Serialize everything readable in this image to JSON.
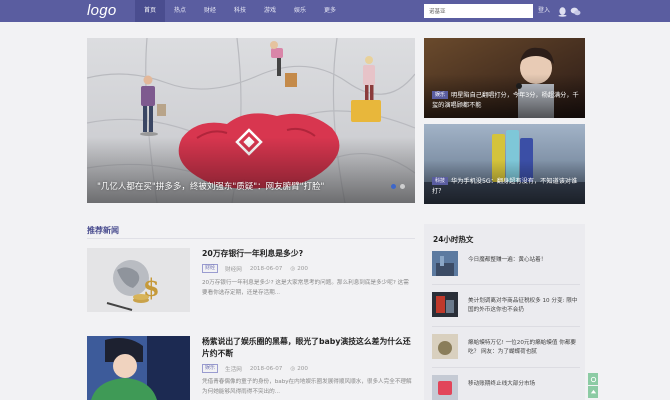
{
  "header": {
    "logo": "logo",
    "nav": [
      "首页",
      "热点",
      "财经",
      "科技",
      "游戏",
      "娱乐",
      "更多"
    ],
    "search_value": "诺基亚",
    "login": "登入",
    "icons": [
      "qq-icon",
      "wechat-icon"
    ]
  },
  "hero": {
    "caption": "\"几亿人都在买\"拼多多，终被刘强东\"质疑\"：网友腑臂\"打脸\"",
    "slides": 2,
    "active_slide": 1
  },
  "side_cards": [
    {
      "tag": "娱乐",
      "text": "明星陷自己翻唱打分，今年3分，杨超满分，千玺的演唱顾都不能"
    },
    {
      "tag": "科技",
      "text": "华为手机没5G：翻身超有没有，不知道该对谁打？"
    }
  ],
  "section": {
    "title": "推荐新闻"
  },
  "news": [
    {
      "title": "20万存银行一年利息是多少?",
      "category": "财经",
      "source": "财经网",
      "date": "2018-06-07",
      "comments": "200",
      "summary": "20万存银行一年利息是多少? 这是大家常思考的问题。那么利息到底是多少呢? 这需要看你选存定期，还是存活期..."
    },
    {
      "title": "杨紫说出了娱乐圈的黑幕，眼光了baby演技这么差为什么还片约不断",
      "category": "娱乐",
      "source": "生活网",
      "date": "2018-06-07",
      "comments": "200",
      "summary": "凭借青春偶像的童子的身份，baby在内地娱乐圈发展得顺风顺水，很多人完全不理解为何她能够风得雨得不突出的..."
    }
  ],
  "hot": {
    "title": "24小时热文",
    "items": [
      "今日魔都整赚一遍：黄心站着！",
      "美计划调离对华商品征税权多 10 分变: 限中国的外币这你也不会扔",
      "癞蛤蟆特万亿! 一位20元的癞蛤蟆值 你都要吃？ 网友：为了蝴蝶荷也腻",
      "移动账期终止线大部分市场"
    ]
  },
  "colors": {
    "nav_bg": "#5a5da0",
    "accent": "#4a4d8f",
    "page_bg": "#f2f2f4"
  }
}
